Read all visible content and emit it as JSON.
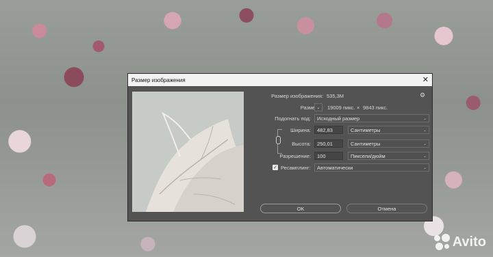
{
  "dialog": {
    "title": "Размер изображения",
    "close_symbol": "✕"
  },
  "info": {
    "image_size_label": "Размер изображения:",
    "image_size_value": "535,3M",
    "dimensions_label": "Размеры:",
    "dimensions_width": "19009 пикс.",
    "dimensions_x": "×",
    "dimensions_height": "9843 пикс."
  },
  "fit": {
    "label": "Подогнать под:",
    "value": "Исходный размер"
  },
  "width": {
    "label": "Ширина:",
    "value": "482,83",
    "unit": "Сантиметры"
  },
  "height": {
    "label": "Высота:",
    "value": "250,01",
    "unit": "Сантиметры"
  },
  "resolution": {
    "label": "Разрешение:",
    "value": "100",
    "unit": "Пиксели/дюйм"
  },
  "resample": {
    "label": "Ресамплинг:",
    "value": "Автоматически",
    "checked": true
  },
  "buttons": {
    "ok": "OK",
    "cancel": "Отмена"
  },
  "icons": {
    "settings": "gear-icon",
    "link": "chain-link-icon",
    "dropdown": "chevron-down-icon"
  },
  "watermark": {
    "text": "Avito"
  }
}
